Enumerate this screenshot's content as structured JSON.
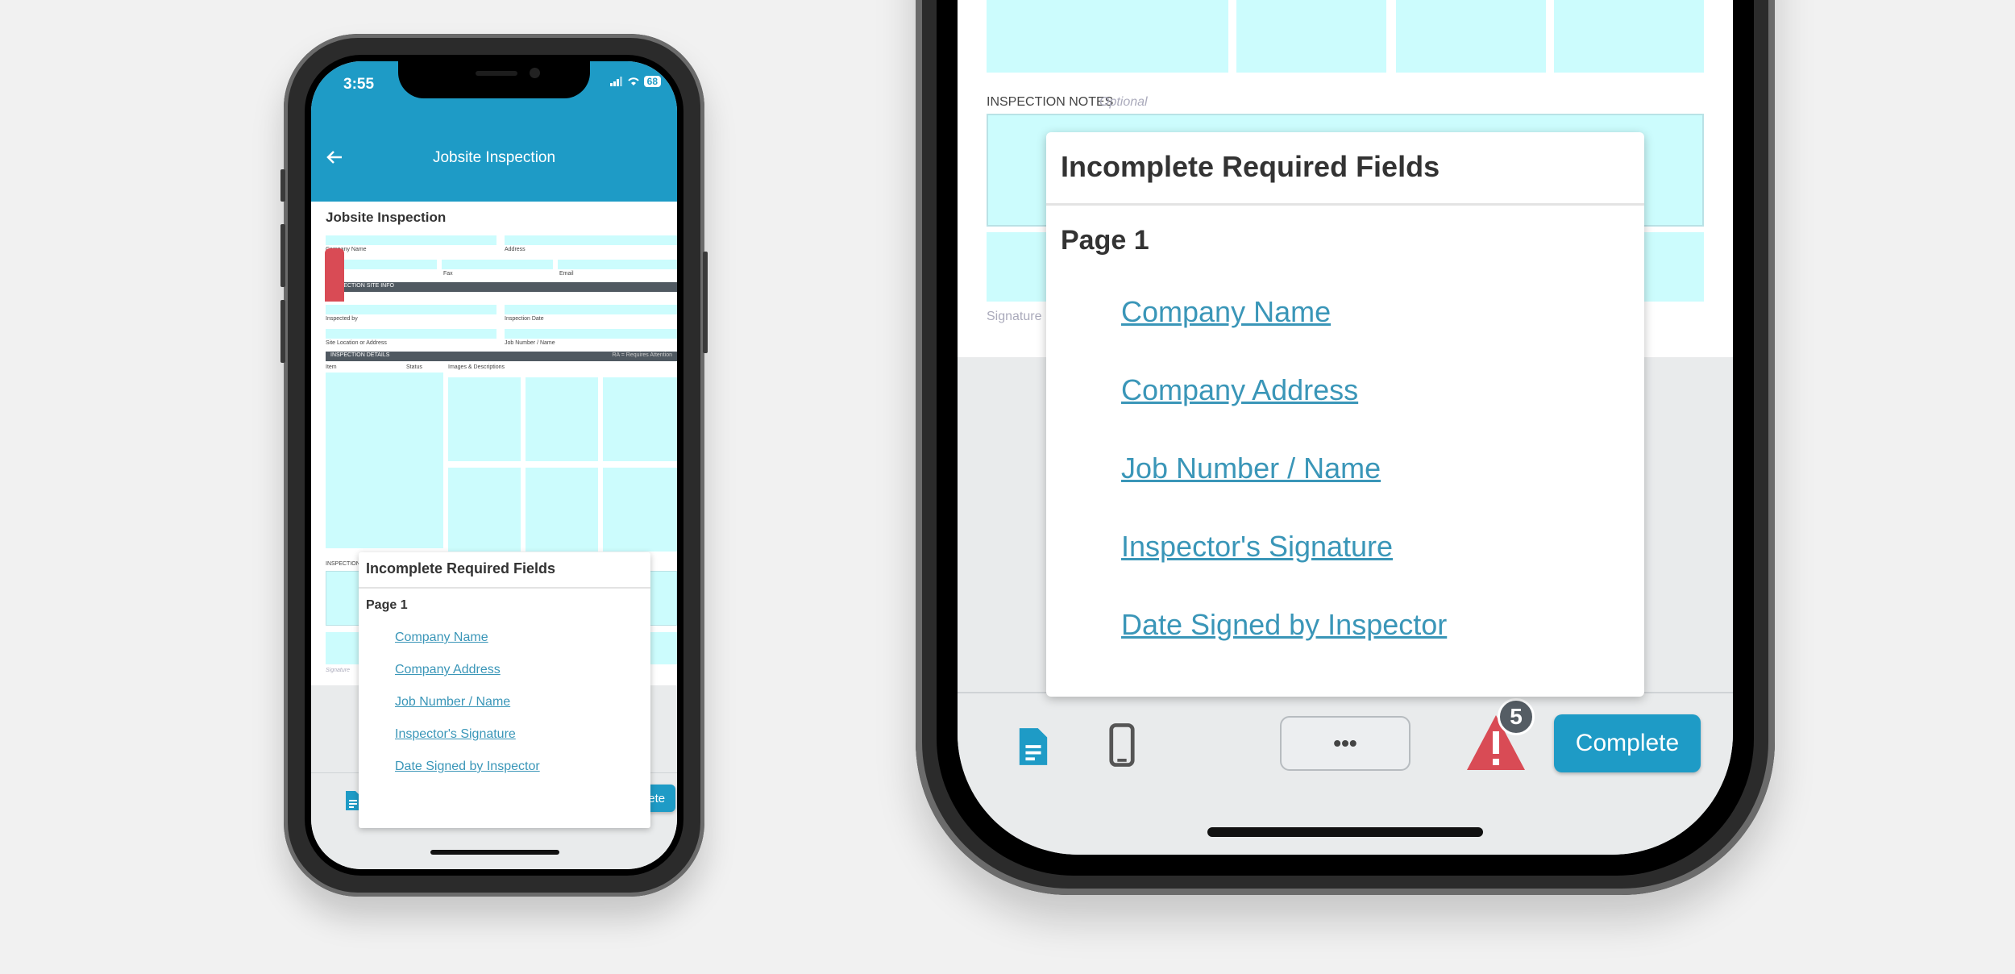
{
  "status": {
    "time": "3:55",
    "battery": "68"
  },
  "appbar": {
    "title": "Jobsite Inspection"
  },
  "doc": {
    "title": "Jobsite Inspection",
    "field_company_name": "Company Name",
    "field_address": "Address",
    "field_fax": "Fax",
    "field_email": "Email",
    "section_site_info": "INSPECTION SITE INFO",
    "field_inspected_by": "Inspected by",
    "field_inspection_date": "Inspection Date",
    "field_site_location": "Site Location or Address",
    "field_job_number": "Job Number / Name",
    "section_details": "INSPECTION DETAILS",
    "details_note": "RA = Requires Attention",
    "col_item": "Item",
    "col_status": "Status",
    "col_images": "Images & Descriptions",
    "notes_label": "INSPECTION NOTES",
    "notes_optional": "Optional",
    "signature_label": "Signature"
  },
  "popup": {
    "title": "Incomplete Required Fields",
    "page": "Page 1",
    "links": [
      "Company Name",
      "Company Address",
      "Job Number / Name",
      "Inspector's Signature",
      "Date Signed by Inspector"
    ]
  },
  "footer": {
    "more_label": "•••",
    "badge_count": "5",
    "complete_label": "Complete"
  },
  "icons": {
    "back": "arrow-left-icon",
    "document": "document-icon",
    "phone": "phone-icon",
    "warning": "warning-icon"
  },
  "colors": {
    "brand": "#1e9bc6",
    "field_fill": "#ccfcfd",
    "warning": "#d94b55",
    "link": "#3a96b8"
  }
}
